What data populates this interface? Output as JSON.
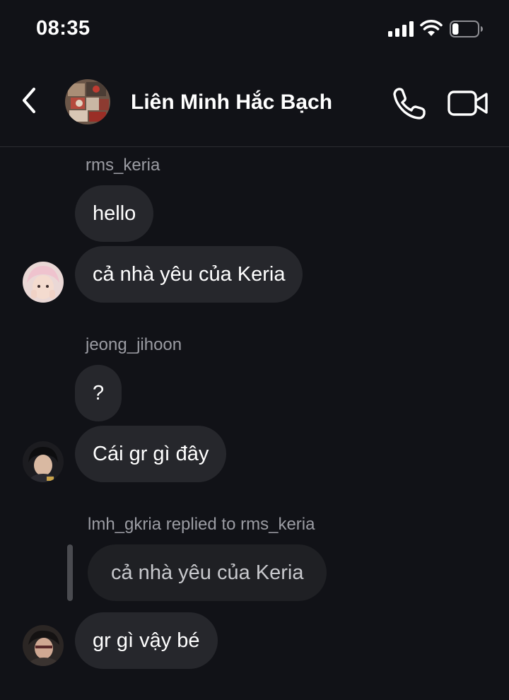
{
  "status_bar": {
    "time": "08:35",
    "battery_level": 0.25
  },
  "header": {
    "title": "Liên Minh Hắc Bạch"
  },
  "messages": [
    {
      "sender": "rms_keria",
      "bubbles": [
        "hello",
        "cả nhà yêu của Keria"
      ]
    },
    {
      "sender": "jeong_jihoon",
      "bubbles": [
        "?",
        "Cái gr gì đây"
      ]
    },
    {
      "sender": "lmh_gkria replied to rms_keria",
      "quoted": "cả nhà yêu của Keria",
      "bubbles": [
        "gr gì vậy bé"
      ]
    }
  ]
}
